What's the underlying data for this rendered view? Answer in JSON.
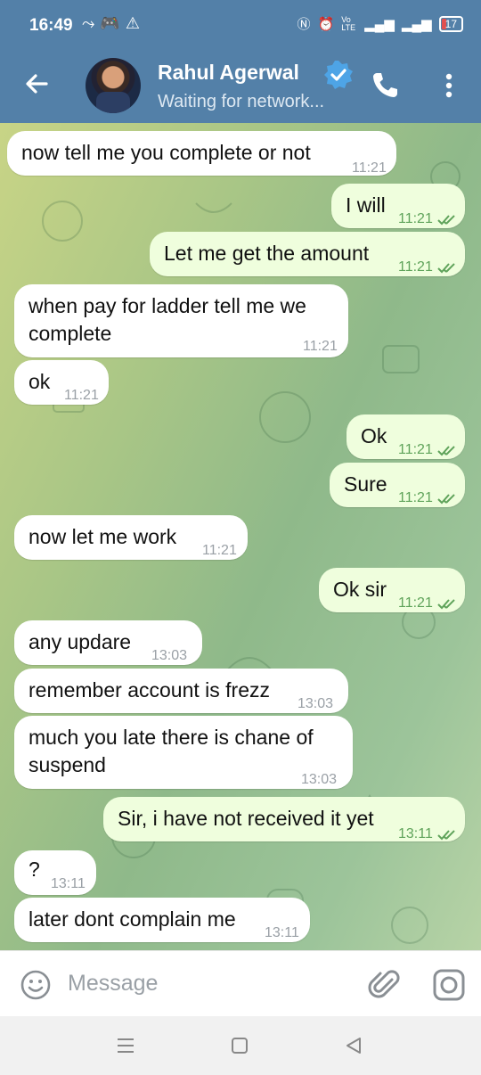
{
  "status_bar": {
    "time": "16:49",
    "left_icons": [
      "missed-call-icon",
      "gamepad-icon",
      "warning-icon"
    ],
    "right_icons": [
      "nfc-icon",
      "alarm-icon",
      "volte-icon",
      "signal-icon",
      "signal-icon"
    ],
    "volte_label": "Vo LTE",
    "battery": "17"
  },
  "header": {
    "title": "Rahul Agerwal",
    "subtitle": "Waiting for network...",
    "verified": true,
    "accent_color": "#5380a8"
  },
  "messages": [
    {
      "dir": "in",
      "text": "now tell me you complete or not",
      "time": "11:21"
    },
    {
      "dir": "out",
      "text": "I will",
      "time": "11:21",
      "read": true
    },
    {
      "dir": "out",
      "text": "Let me get the amount",
      "time": "11:21",
      "read": true
    },
    {
      "dir": "in",
      "text": "when pay for ladder tell me we\ncomplete",
      "time": "11:21"
    },
    {
      "dir": "in",
      "text": "ok",
      "time": "11:21"
    },
    {
      "dir": "out",
      "text": "Ok",
      "time": "11:21",
      "read": true
    },
    {
      "dir": "out",
      "text": "Sure",
      "time": "11:21",
      "read": true
    },
    {
      "dir": "in",
      "text": "now let me work",
      "time": "11:21"
    },
    {
      "dir": "out",
      "text": "Ok sir",
      "time": "11:21",
      "read": true
    },
    {
      "dir": "in",
      "text": "any updare",
      "time": "13:03"
    },
    {
      "dir": "in",
      "text": "remember account is frezz",
      "time": "13:03"
    },
    {
      "dir": "in",
      "text": "much you late there is chane of\nsuspend",
      "time": "13:03"
    },
    {
      "dir": "out",
      "text": "Sir, i have not received it yet",
      "time": "13:11",
      "read": true
    },
    {
      "dir": "in",
      "text": "?",
      "time": "13:11"
    },
    {
      "dir": "in",
      "text": "later dont complain me",
      "time": "13:11"
    }
  ],
  "input": {
    "placeholder": "Message"
  },
  "colors": {
    "incoming_bubble": "#ffffff",
    "outgoing_bubble": "#effedd",
    "read_tick": "#5fa35a"
  }
}
